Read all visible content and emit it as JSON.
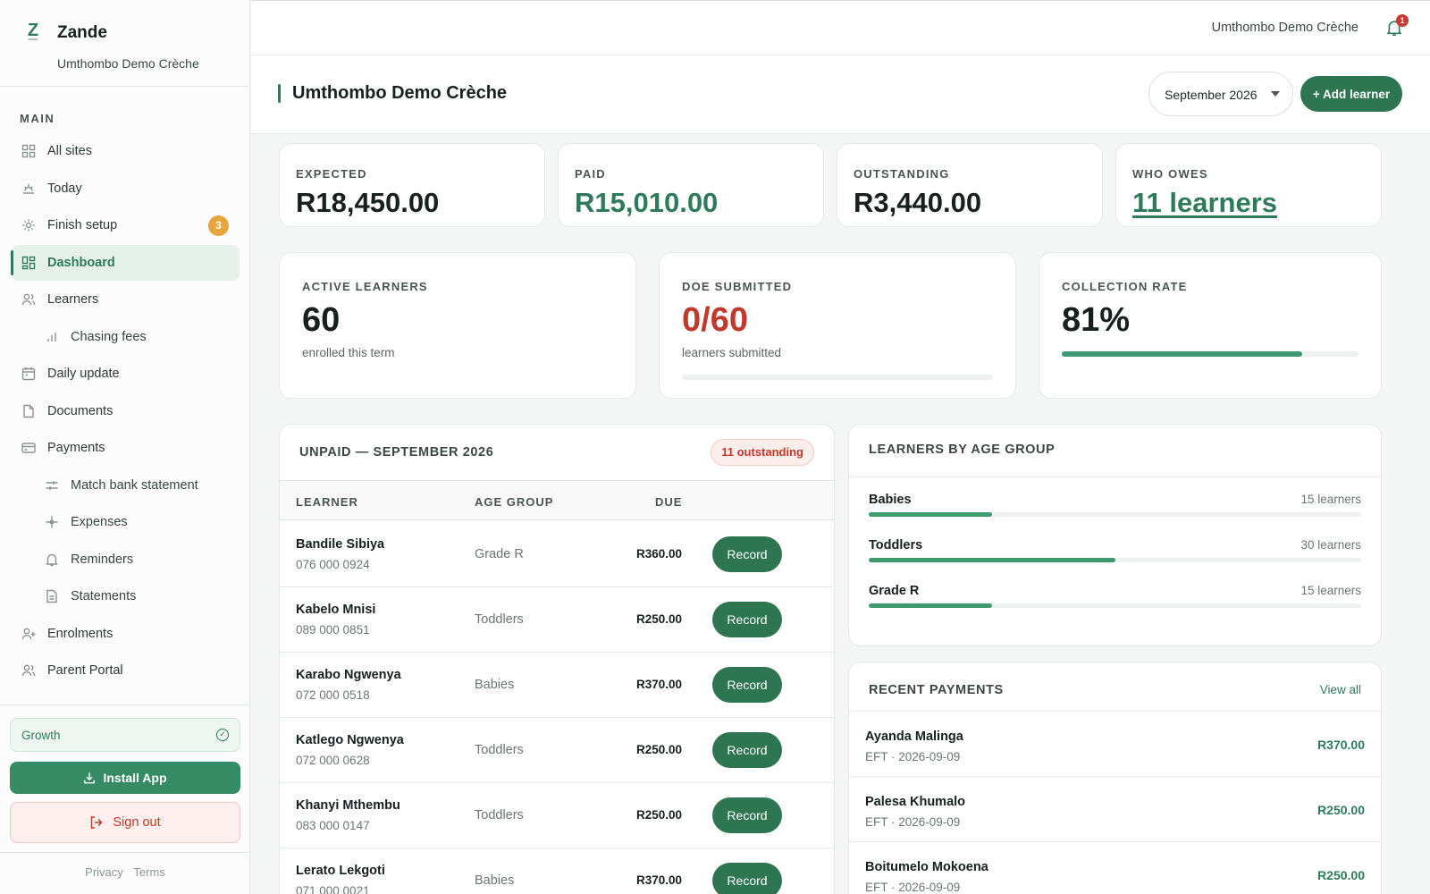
{
  "brand": {
    "name": "Zande",
    "logo_letter": "Z",
    "logo_sub": "zande",
    "site": "Umthombo Demo Crèche"
  },
  "sidebar": {
    "section_label": "MAIN",
    "items": [
      {
        "label": "All sites",
        "icon": "grid-icon"
      },
      {
        "label": "Today",
        "icon": "sunrise-icon"
      },
      {
        "label": "Finish setup",
        "icon": "gear-icon",
        "badge": "3"
      },
      {
        "label": "Dashboard",
        "icon": "dashboard-icon",
        "active": true
      },
      {
        "label": "Learners",
        "icon": "users-icon"
      },
      {
        "label": "Chasing fees",
        "icon": "bar-chart-icon",
        "sub": true
      },
      {
        "label": "Daily update",
        "icon": "calendar-icon"
      },
      {
        "label": "Documents",
        "icon": "document-icon"
      },
      {
        "label": "Payments",
        "icon": "card-icon"
      },
      {
        "label": "Match bank statement",
        "icon": "sliders-icon",
        "sub": true
      },
      {
        "label": "Expenses",
        "icon": "sparkle-icon",
        "sub": true
      },
      {
        "label": "Reminders",
        "icon": "bell-icon",
        "sub": true
      },
      {
        "label": "Statements",
        "icon": "file-icon",
        "sub": true
      },
      {
        "label": "Enrolments",
        "icon": "user-plus-icon"
      },
      {
        "label": "Parent Portal",
        "icon": "users-icon"
      }
    ],
    "plan_label": "Growth",
    "install_label": "Install App",
    "signout_label": "Sign out",
    "privacy_label": "Privacy",
    "terms_label": "Terms"
  },
  "topbar": {
    "site": "Umthombo Demo Crèche",
    "notification_count": "1"
  },
  "header": {
    "title": "Umthombo Demo Crèche",
    "month": "September 2026",
    "add_label": "+ Add learner"
  },
  "stats": [
    {
      "label": "EXPECTED",
      "value": "R18,450.00"
    },
    {
      "label": "PAID",
      "value": "R15,010.00"
    },
    {
      "label": "OUTSTANDING",
      "value": "R3,440.00"
    },
    {
      "label": "WHO OWES",
      "value": "11 learners"
    }
  ],
  "kpis": {
    "active": {
      "label": "ACTIVE LEARNERS",
      "value": "60",
      "sub": "enrolled this term"
    },
    "doe": {
      "label": "DOE SUBMITTED",
      "value": "0/60",
      "sub": "learners submitted",
      "progress": 0
    },
    "collection": {
      "label": "COLLECTION RATE",
      "value": "81%",
      "progress": 0.81
    }
  },
  "unpaid": {
    "title": "UNPAID — SEPTEMBER 2026",
    "badge": "11 outstanding",
    "columns": {
      "learner": "LEARNER",
      "age_group": "AGE GROUP",
      "due": "DUE"
    },
    "record_label": "Record",
    "rows": [
      {
        "name": "Bandile Sibiya",
        "phone": "076 000 0924",
        "group": "Grade R",
        "due": "R360.00"
      },
      {
        "name": "Kabelo Mnisi",
        "phone": "089 000 0851",
        "group": "Toddlers",
        "due": "R250.00"
      },
      {
        "name": "Karabo Ngwenya",
        "phone": "072 000 0518",
        "group": "Babies",
        "due": "R370.00"
      },
      {
        "name": "Katlego Ngwenya",
        "phone": "072 000 0628",
        "group": "Toddlers",
        "due": "R250.00"
      },
      {
        "name": "Khanyi Mthembu",
        "phone": "083 000 0147",
        "group": "Toddlers",
        "due": "R250.00"
      },
      {
        "name": "Lerato Lekgoti",
        "phone": "071 000 0021",
        "group": "Babies",
        "due": "R370.00"
      }
    ]
  },
  "age_groups": {
    "title": "LEARNERS BY AGE GROUP",
    "rows": [
      {
        "name": "Babies",
        "count": "15 learners",
        "share": 0.25
      },
      {
        "name": "Toddlers",
        "count": "30 learners",
        "share": 0.5
      },
      {
        "name": "Grade R",
        "count": "15 learners",
        "share": 0.25
      }
    ]
  },
  "recent_payments": {
    "title": "RECENT PAYMENTS",
    "view_all": "View all",
    "rows": [
      {
        "name": "Ayanda Malinga",
        "meta": "EFT · 2026-09-09",
        "amount": "R370.00"
      },
      {
        "name": "Palesa Khumalo",
        "meta": "EFT · 2026-09-09",
        "amount": "R250.00"
      },
      {
        "name": "Boitumelo Mokoena",
        "meta": "EFT · 2026-09-09",
        "amount": "R250.00"
      }
    ]
  },
  "colors": {
    "brand": "#2f7a5b",
    "button": "#2e7552",
    "danger": "#c0392b",
    "badge": "#e8a53c"
  }
}
